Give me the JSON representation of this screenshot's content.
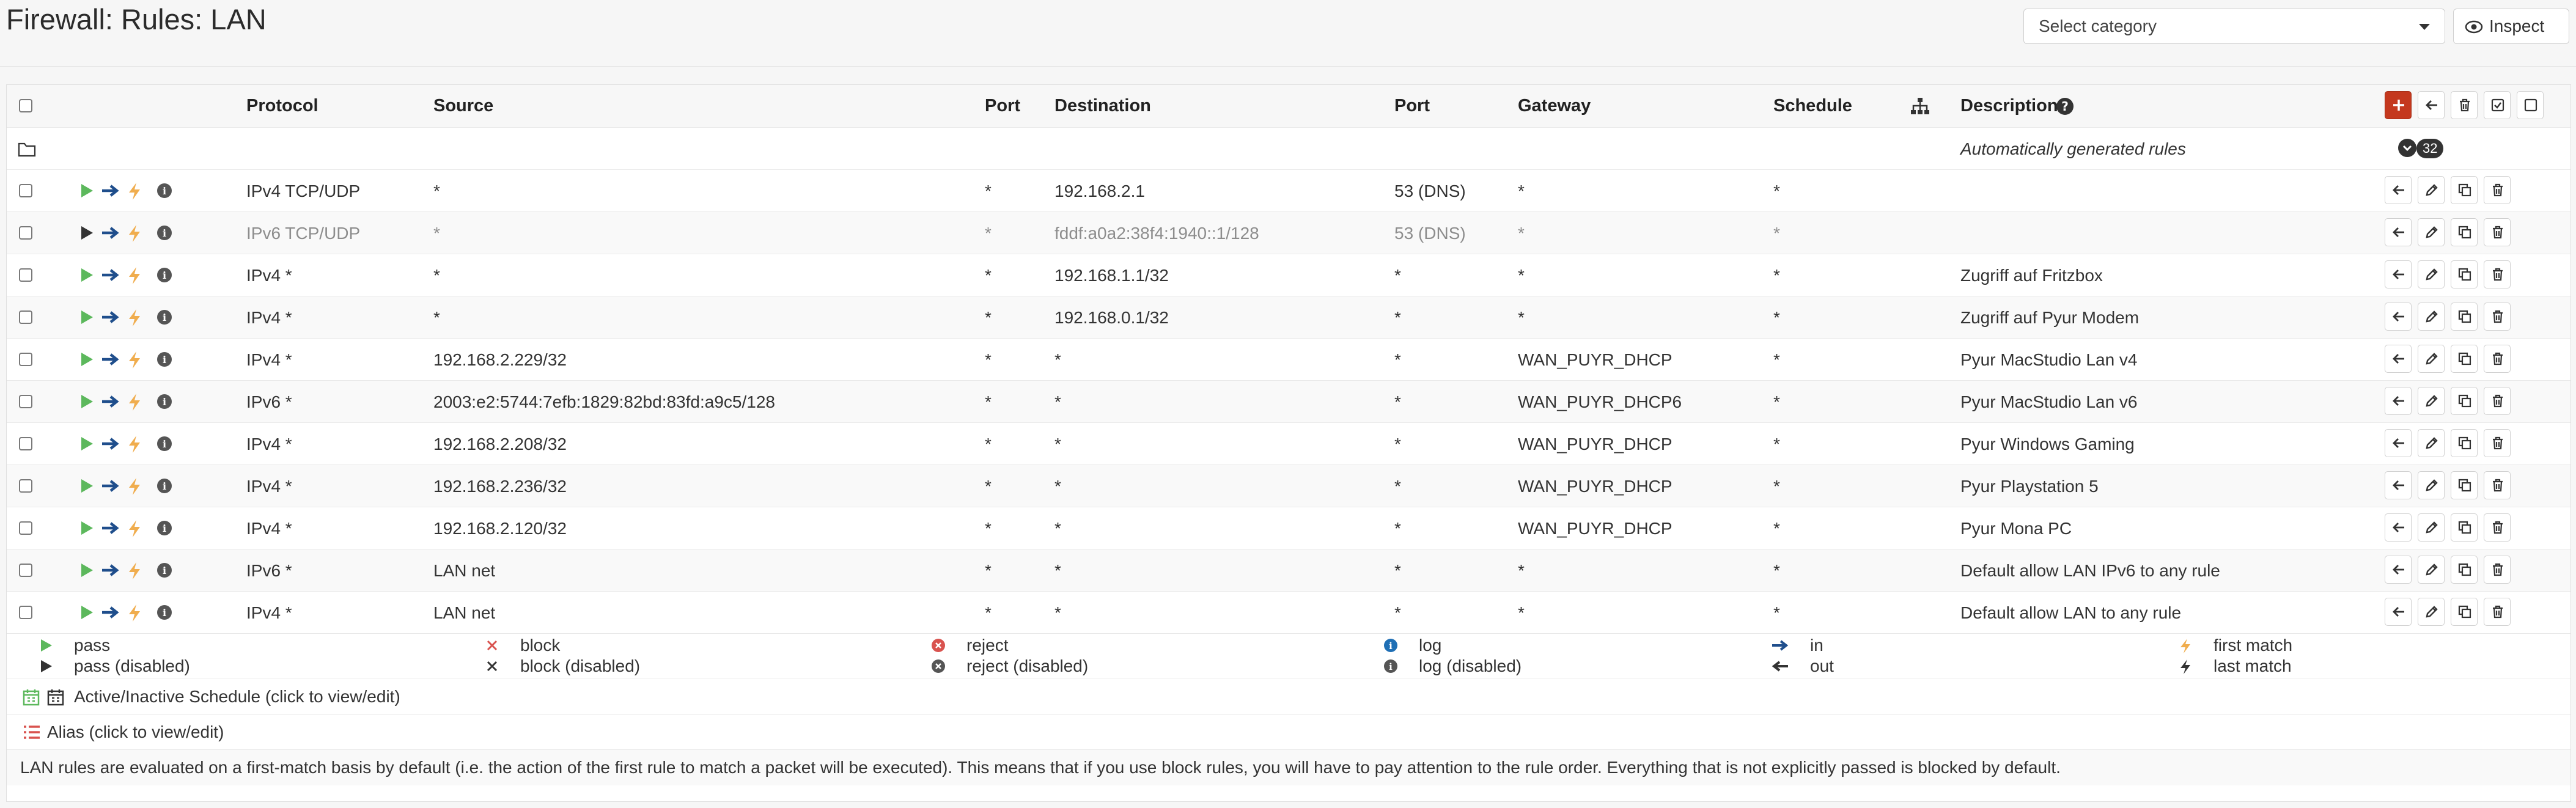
{
  "page": {
    "title": "Firewall: Rules: LAN"
  },
  "toolbar": {
    "category_placeholder": "Select category",
    "inspect_label": "Inspect"
  },
  "table": {
    "headers": {
      "protocol": "Protocol",
      "source": "Source",
      "src_port": "Port",
      "destination": "Destination",
      "dst_port": "Port",
      "gateway": "Gateway",
      "schedule": "Schedule",
      "description": "Description"
    },
    "auto_rules": {
      "label": "Automatically generated rules",
      "count": "32"
    },
    "rows": [
      {
        "protocol": "IPv4 TCP/UDP",
        "source": "*",
        "src_port": "*",
        "destination": "192.168.2.1",
        "dst_port": "53 (DNS)",
        "gateway": "*",
        "schedule": "*",
        "description": "",
        "enabled": true
      },
      {
        "protocol": "IPv6 TCP/UDP",
        "source": "*",
        "src_port": "*",
        "destination": "fddf:a0a2:38f4:1940::1/128",
        "dst_port": "53 (DNS)",
        "gateway": "*",
        "schedule": "*",
        "description": "",
        "enabled": false
      },
      {
        "protocol": "IPv4 *",
        "source": "*",
        "src_port": "*",
        "destination": "192.168.1.1/32",
        "dst_port": "*",
        "gateway": "*",
        "schedule": "*",
        "description": "Zugriff auf Fritzbox",
        "enabled": true
      },
      {
        "protocol": "IPv4 *",
        "source": "*",
        "src_port": "*",
        "destination": "192.168.0.1/32",
        "dst_port": "*",
        "gateway": "*",
        "schedule": "*",
        "description": "Zugriff auf Pyur Modem",
        "enabled": true
      },
      {
        "protocol": "IPv4 *",
        "source": "192.168.2.229/32",
        "src_port": "*",
        "destination": "*",
        "dst_port": "*",
        "gateway": "WAN_PUYR_DHCP",
        "schedule": "*",
        "description": "Pyur MacStudio Lan v4",
        "enabled": true
      },
      {
        "protocol": "IPv6 *",
        "source": "2003:e2:5744:7efb:1829:82bd:83fd:a9c5/128",
        "src_port": "*",
        "destination": "*",
        "dst_port": "*",
        "gateway": "WAN_PUYR_DHCP6",
        "schedule": "*",
        "description": "Pyur MacStudio Lan v6",
        "enabled": true
      },
      {
        "protocol": "IPv4 *",
        "source": "192.168.2.208/32",
        "src_port": "*",
        "destination": "*",
        "dst_port": "*",
        "gateway": "WAN_PUYR_DHCP",
        "schedule": "*",
        "description": "Pyur Windows Gaming",
        "enabled": true
      },
      {
        "protocol": "IPv4 *",
        "source": "192.168.2.236/32",
        "src_port": "*",
        "destination": "*",
        "dst_port": "*",
        "gateway": "WAN_PUYR_DHCP",
        "schedule": "*",
        "description": "Pyur Playstation 5",
        "enabled": true
      },
      {
        "protocol": "IPv4 *",
        "source": "192.168.2.120/32",
        "src_port": "*",
        "destination": "*",
        "dst_port": "*",
        "gateway": "WAN_PUYR_DHCP",
        "schedule": "*",
        "description": "Pyur Mona PC",
        "enabled": true
      },
      {
        "protocol": "IPv6 *",
        "source": "LAN net",
        "src_port": "*",
        "destination": "*",
        "dst_port": "*",
        "gateway": "*",
        "schedule": "*",
        "description": "Default allow LAN IPv6 to any rule",
        "enabled": true
      },
      {
        "protocol": "IPv4 *",
        "source": "LAN net",
        "src_port": "*",
        "destination": "*",
        "dst_port": "*",
        "gateway": "*",
        "schedule": "*",
        "description": "Default allow LAN to any rule",
        "enabled": true
      }
    ]
  },
  "legend": {
    "pass": "pass",
    "pass_disabled": "pass (disabled)",
    "block": "block",
    "block_disabled": "block (disabled)",
    "reject": "reject",
    "reject_disabled": "reject (disabled)",
    "log": "log",
    "log_disabled": "log (disabled)",
    "in": "in",
    "out": "out",
    "first_match": "first match",
    "last_match": "last match"
  },
  "footer": {
    "schedule": "Active/Inactive Schedule (click to view/edit)",
    "alias": "Alias (click to view/edit)",
    "note": "LAN rules are evaluated on a first-match basis by default (i.e. the action of the first rule to match a packet will be executed). This means that if you use block rules, you will have to pay attention to the rule order. Everything that is not explicitly passed is blocked by default."
  },
  "colors": {
    "pass": "#5cb85c",
    "in_arrow": "#1f4e8c",
    "first_match": "#f0ad4e",
    "add_button": "#c4381e"
  }
}
